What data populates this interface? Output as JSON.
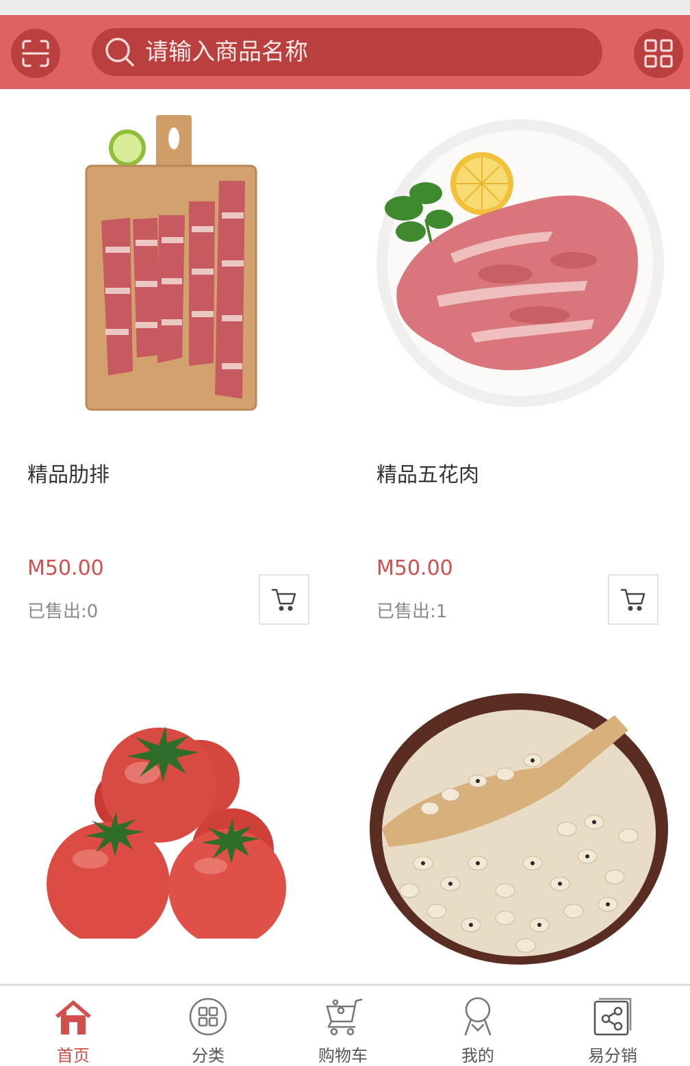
{
  "header": {
    "search_placeholder": "请输入商品名称"
  },
  "products": [
    {
      "name": "精品肋排",
      "price": "M50.00",
      "sold": "已售出:0"
    },
    {
      "name": "精品五花肉",
      "price": "M50.00",
      "sold": "已售出:1"
    },
    {
      "name": "",
      "price": "",
      "sold": ""
    },
    {
      "name": "",
      "price": "",
      "sold": ""
    }
  ],
  "tabbar": {
    "items": [
      {
        "label": "首页",
        "icon": "home-icon",
        "active": true
      },
      {
        "label": "分类",
        "icon": "category-icon",
        "active": false
      },
      {
        "label": "购物车",
        "icon": "cart-icon",
        "active": false
      },
      {
        "label": "我的",
        "icon": "user-icon",
        "active": false
      },
      {
        "label": "易分销",
        "icon": "share-icon",
        "active": false
      }
    ]
  },
  "colors": {
    "header": "#de6360",
    "header_dark": "#b9403f",
    "price": "#d14f4c",
    "active_tab": "#d14f4c"
  }
}
